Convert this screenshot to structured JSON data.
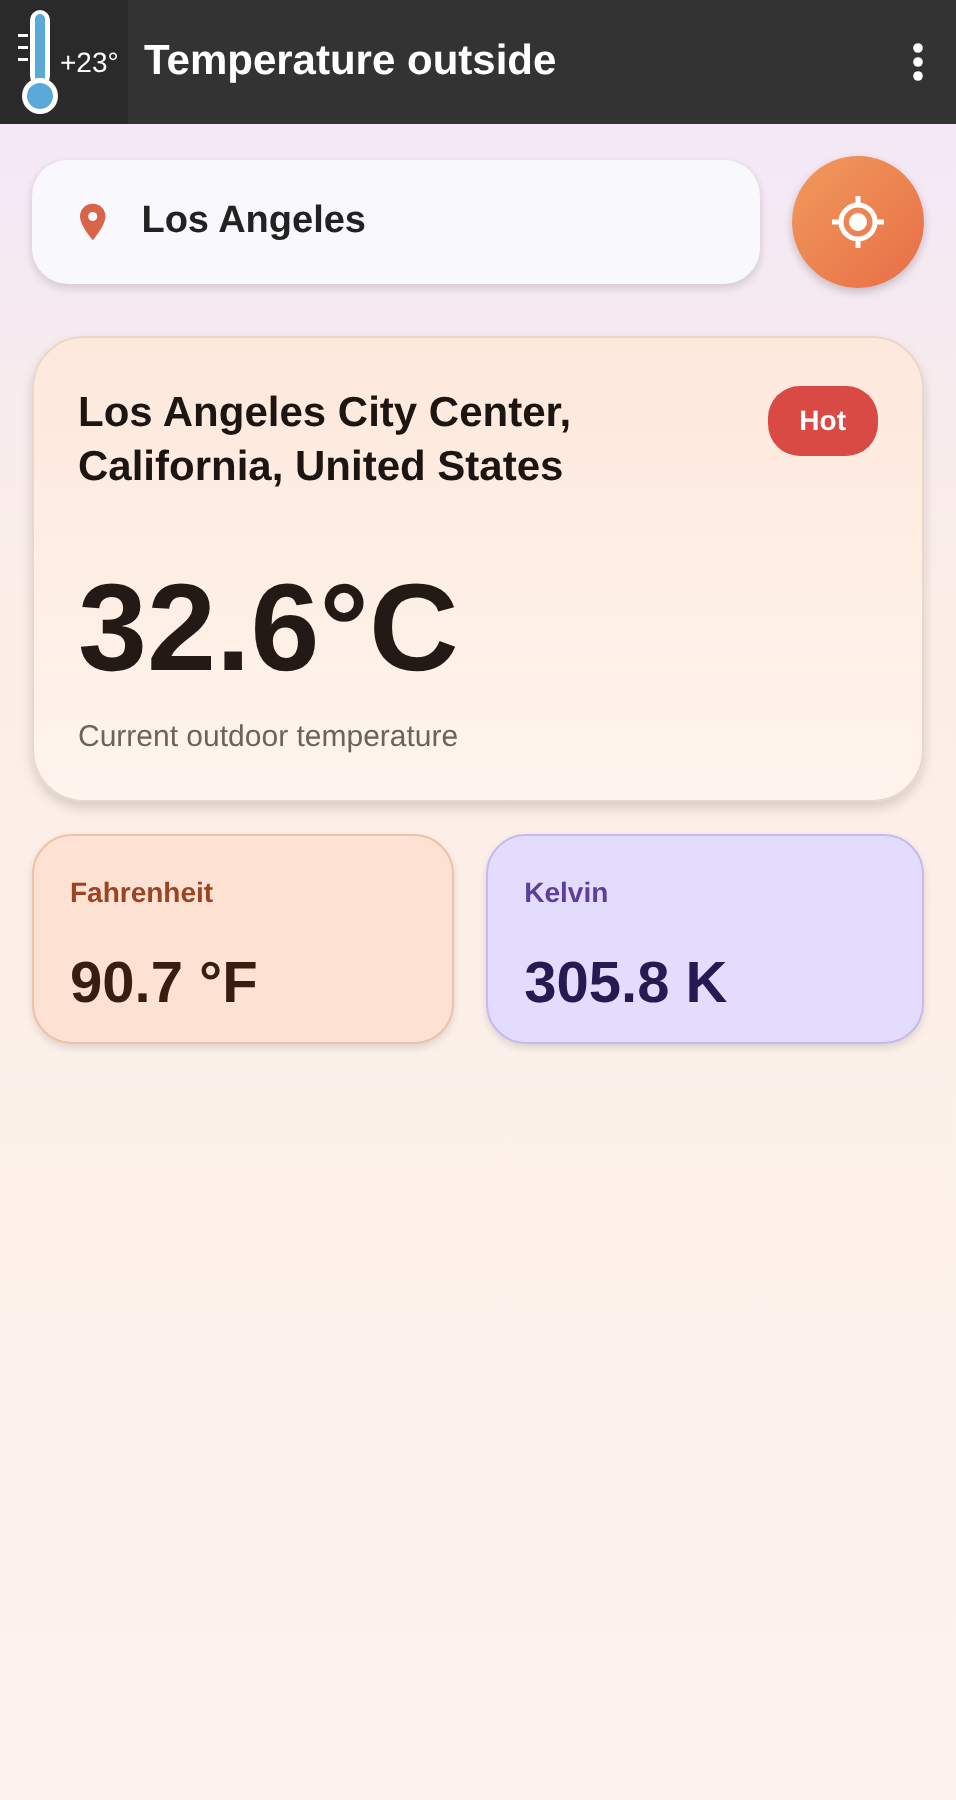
{
  "app_bar": {
    "icon_text": "+23°",
    "title": "Temperature outside"
  },
  "search": {
    "value": "Los Angeles"
  },
  "current": {
    "location": "Los Angeles City Center, California, United States",
    "badge": {
      "label": "Hot",
      "kind": "hot"
    },
    "temperature": "32.6°C",
    "caption": "Current outdoor temperature"
  },
  "units": [
    {
      "label": "Fahrenheit",
      "value": "90.7 °F",
      "kind": "warm"
    },
    {
      "label": "Kelvin",
      "value": "305.8 K",
      "kind": "cool"
    }
  ]
}
